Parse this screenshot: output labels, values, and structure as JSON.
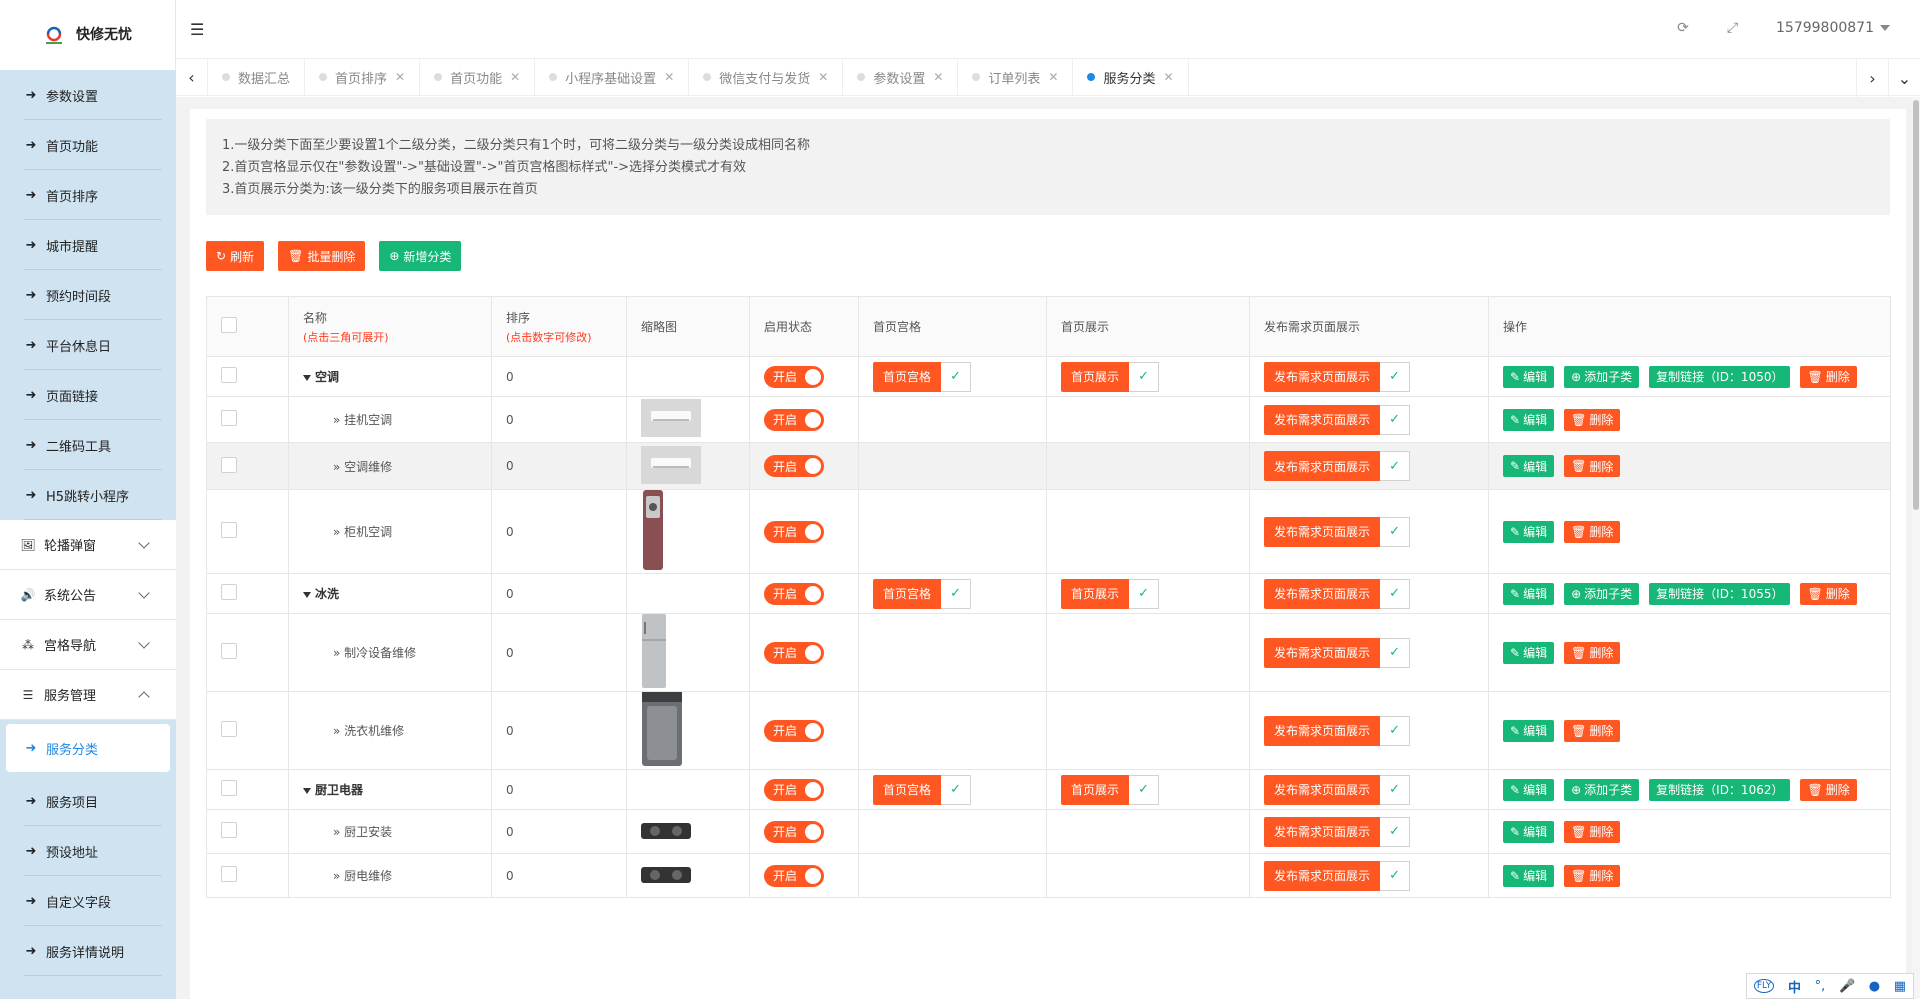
{
  "brand": {
    "name": "快修无忧",
    "logo_icon": "brand-logo-icon"
  },
  "topbar": {
    "refresh_icon": "refresh-icon",
    "fullscreen_icon": "fullscreen-icon",
    "phone": "15799800871"
  },
  "tabs": [
    {
      "label": "数据汇总",
      "closable": false
    },
    {
      "label": "首页排序"
    },
    {
      "label": "首页功能"
    },
    {
      "label": "小程序基础设置"
    },
    {
      "label": "微信支付与发货"
    },
    {
      "label": "参数设置"
    },
    {
      "label": "订单列表"
    },
    {
      "label": "服务分类",
      "active": true
    }
  ],
  "sidebar": {
    "items_top": [
      "参数设置",
      "首页功能",
      "首页排序",
      "城市提醒",
      "预约时间段",
      "平台休息日",
      "页面链接",
      "二维码工具",
      "H5跳转小程序"
    ],
    "groups": [
      "轮播弹窗",
      "系统公告",
      "宫格导航",
      "服务管理"
    ],
    "active": "服务分类",
    "items_bottom": [
      "服务项目",
      "预设地址",
      "自定义字段",
      "服务详情说明"
    ]
  },
  "notice": [
    "1.一级分类下面至少要设置1个二级分类，二级分类只有1个时，可将二级分类与一级分类设成相同名称",
    "2.首页宫格显示仅在\"参数设置\"->\"基础设置\"->\"首页宫格图标样式\"->选择分类模式才有效",
    "3.首页展示分类为:该一级分类下的服务项目展示在首页"
  ],
  "toolbar": {
    "refresh": "刷新",
    "batch_delete": "批量删除",
    "add": "新增分类"
  },
  "table": {
    "headers": {
      "name": "名称",
      "name_hint": "(点击三角可展开)",
      "sort": "排序",
      "sort_hint": "(点击数字可修改)",
      "thumb": "缩略图",
      "status": "启用状态",
      "grid": "首页宫格",
      "home": "首页展示",
      "publish": "发布需求页面展示",
      "ops": "操作"
    },
    "labels": {
      "on": "开启",
      "grid": "首页宫格",
      "home": "首页展示",
      "publish": "发布需求页面展示",
      "edit": "编辑",
      "add_child": "添加子类",
      "delete": "删除",
      "check": "✓"
    },
    "rows": [
      {
        "level": 1,
        "name": "空调",
        "sort": "0",
        "copy": "复制链接（ID：1050）"
      },
      {
        "level": 2,
        "name": "挂机空调",
        "sort": "0",
        "thumb": "ac"
      },
      {
        "level": 2,
        "name": "空调维修",
        "sort": "0",
        "thumb": "ac"
      },
      {
        "level": 2,
        "name": "柜机空调",
        "sort": "0",
        "thumb": "tower"
      },
      {
        "level": 1,
        "name": "冰洗",
        "sort": "0",
        "copy": "复制链接（ID：1055）"
      },
      {
        "level": 2,
        "name": "制冷设备维修",
        "sort": "0",
        "thumb": "fridge"
      },
      {
        "level": 2,
        "name": "洗衣机维修",
        "sort": "0",
        "thumb": "washer"
      },
      {
        "level": 1,
        "name": "厨卫电器",
        "sort": "0",
        "copy": "复制链接（ID：1062）"
      },
      {
        "level": 2,
        "name": "厨卫安装",
        "sort": "0",
        "thumb": "stove"
      },
      {
        "level": 2,
        "name": "厨电维修",
        "sort": "0",
        "thumb": "stove"
      }
    ]
  },
  "ime": {
    "label": "中"
  },
  "colors": {
    "accent_red": "#ff5722",
    "accent_green": "#16b777",
    "nav_bg": "#cfe3f1",
    "active_blue": "#1e88e5"
  }
}
